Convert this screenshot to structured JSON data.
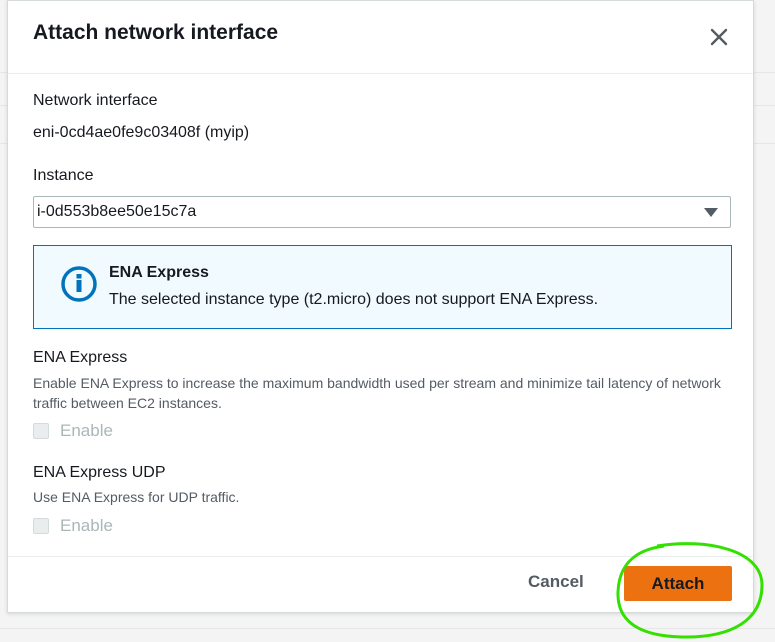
{
  "modal": {
    "title": "Attach network interface"
  },
  "network_interface": {
    "label": "Network interface",
    "value": "eni-0cd4ae0fe9c03408f (myip)"
  },
  "instance": {
    "label": "Instance",
    "selected": "i-0d553b8ee50e15c7a"
  },
  "alert": {
    "title": "ENA Express",
    "text": "The selected instance type (t2.micro) does not support ENA Express."
  },
  "ena_express": {
    "label": "ENA Express",
    "description": "Enable ENA Express to increase the maximum bandwidth used per stream and minimize tail latency of network traffic between EC2 instances.",
    "checkbox_label": "Enable"
  },
  "ena_express_udp": {
    "label": "ENA Express UDP",
    "description": "Use ENA Express for UDP traffic.",
    "checkbox_label": "Enable"
  },
  "footer": {
    "cancel_label": "Cancel",
    "attach_label": "Attach"
  },
  "colors": {
    "primary_button": "#ec7211",
    "info_border": "#0073bb",
    "info_background": "#f1faff",
    "annotation_circle": "#33e000"
  },
  "icons": [
    "close-icon",
    "info-icon",
    "dropdown-caret-icon"
  ]
}
